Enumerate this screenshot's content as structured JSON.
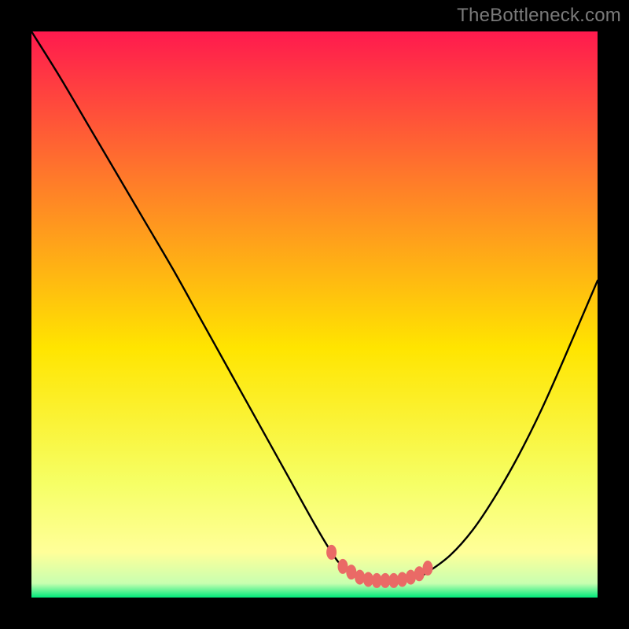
{
  "watermark": "TheBottleneck.com",
  "colors": {
    "bg": "#000000",
    "gradient_top": "#ff1a4e",
    "gradient_mid_top": "#ff7a2a",
    "gradient_mid": "#ffe500",
    "gradient_mid_bot": "#f6ff66",
    "gradient_low": "#ffff99",
    "gradient_bot": "#00e87a",
    "curve": "#000000",
    "dot": "#ea6a66"
  },
  "chart_data": {
    "type": "line",
    "title": "",
    "xlabel": "",
    "ylabel": "",
    "xlim": [
      0,
      100
    ],
    "ylim": [
      0,
      100
    ],
    "series": [
      {
        "name": "bottleneck-curve",
        "x": [
          0,
          5,
          10,
          15,
          20,
          25,
          30,
          35,
          40,
          45,
          50,
          53,
          55,
          58,
          60,
          63,
          65,
          68,
          70,
          74,
          78,
          82,
          86,
          90,
          94,
          100
        ],
        "y": [
          100,
          92,
          83.5,
          75,
          66.5,
          58,
          49,
          40,
          31,
          22,
          13,
          8,
          5.5,
          3.5,
          3,
          3,
          3,
          3.5,
          4.5,
          7.5,
          12,
          18,
          25,
          33,
          42,
          56
        ]
      }
    ],
    "dots": {
      "name": "highlight-dots",
      "x": [
        53,
        55,
        56.5,
        58,
        59.5,
        61,
        62.5,
        64,
        65.5,
        67,
        68.5,
        70
      ],
      "y": [
        8.0,
        5.5,
        4.5,
        3.6,
        3.2,
        3.0,
        3.0,
        3.0,
        3.2,
        3.6,
        4.2,
        5.2
      ]
    }
  }
}
